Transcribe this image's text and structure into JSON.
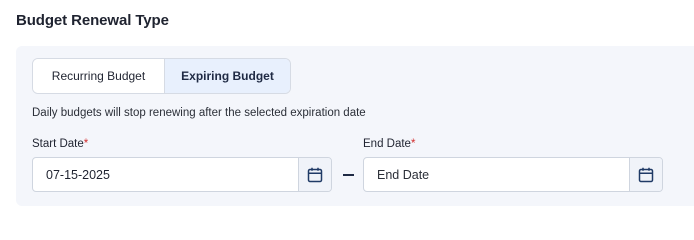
{
  "section": {
    "title": "Budget Renewal Type"
  },
  "toggle": {
    "options": [
      {
        "label": "Recurring Budget",
        "selected": false
      },
      {
        "label": "Expiring Budget",
        "selected": true
      }
    ]
  },
  "helper_text": "Daily budgets will stop renewing after the selected expiration date",
  "start_date": {
    "label": "Start Date",
    "required_marker": "*",
    "value": "07-15-2025"
  },
  "end_date": {
    "label": "End Date",
    "required_marker": "*",
    "value": "",
    "placeholder": "End Date"
  },
  "icons": {
    "calendar": "calendar-icon"
  },
  "colors": {
    "selected_bg": "#e8f0fd",
    "panel_bg": "#f4f6fb",
    "required": "#d32f2f",
    "icon": "#1f3a66"
  }
}
